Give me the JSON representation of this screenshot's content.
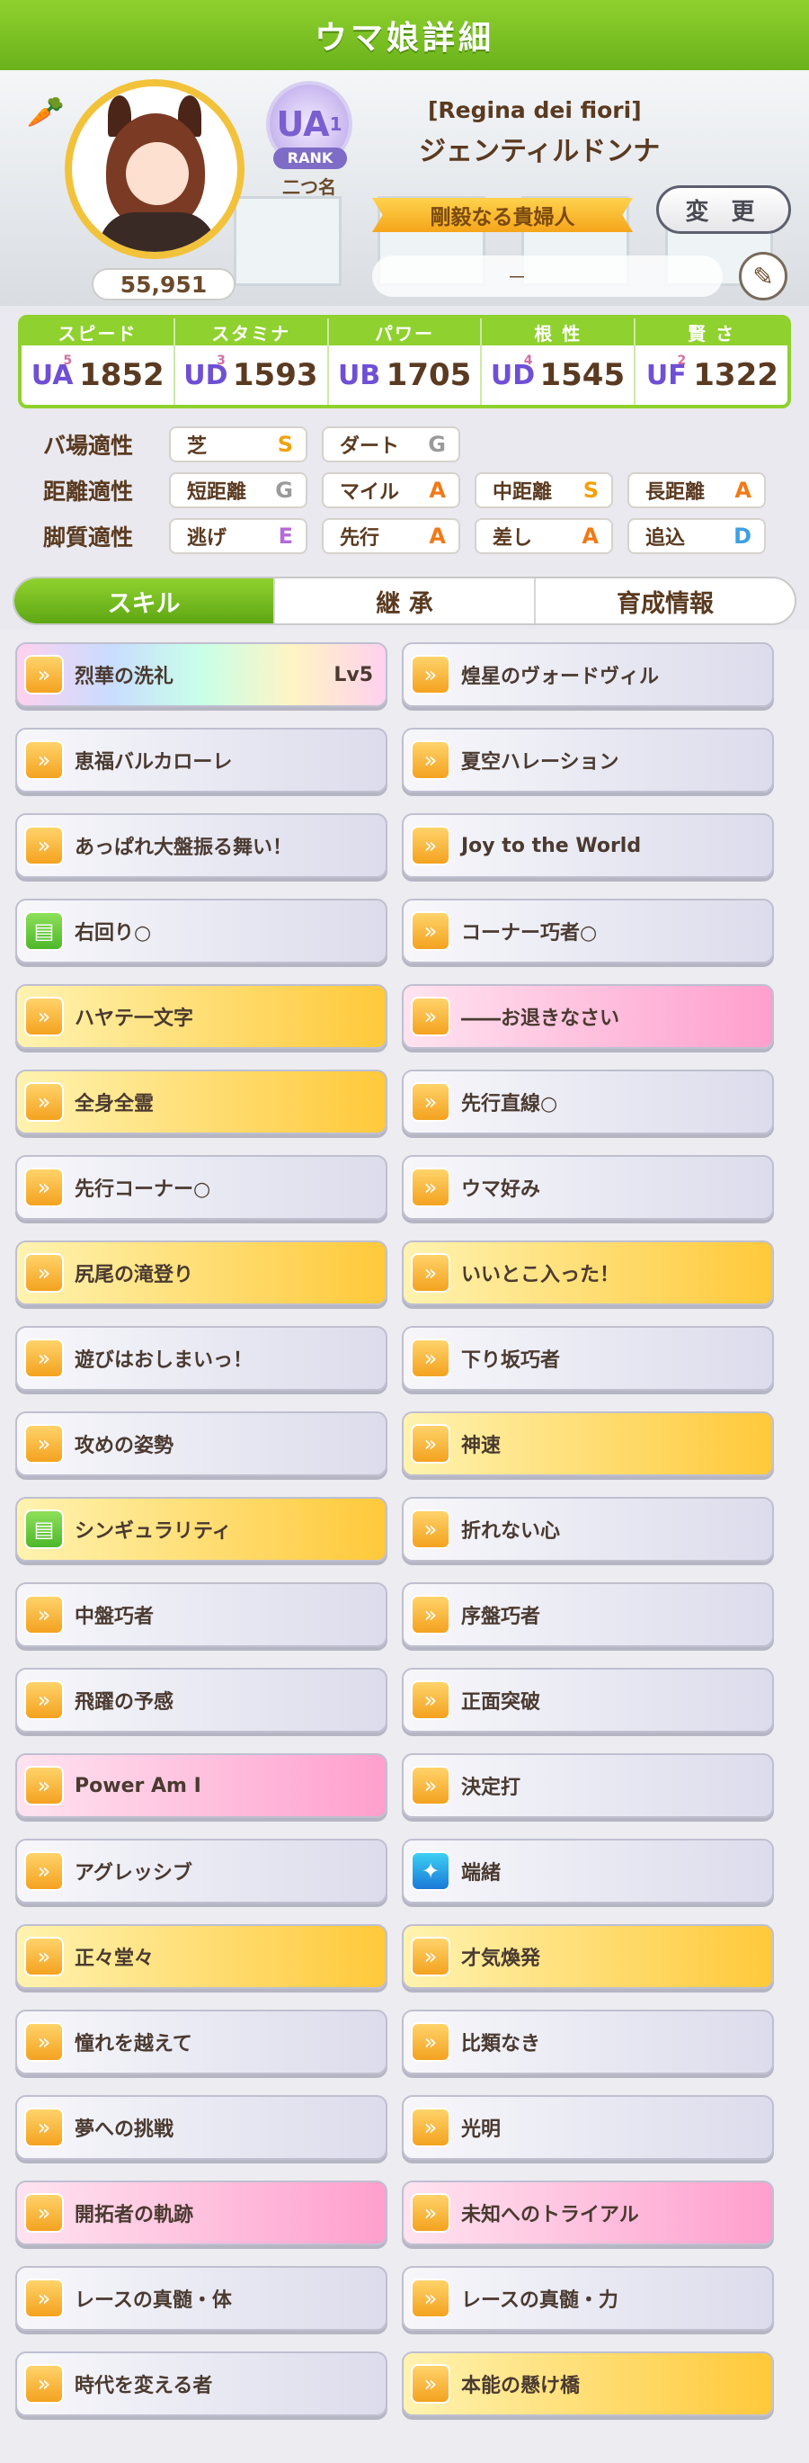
{
  "header": {
    "title": "ウマ娘詳細"
  },
  "profile": {
    "fans": "55,951",
    "rank_grade": "UA",
    "rank_sub": "1",
    "rank_label": "RANK",
    "nickname": "二つ名",
    "epithet": "[Regina dei fiori]",
    "name": "ジェンティルドンナ",
    "title_ribbon": "剛毅なる貴婦人",
    "change_label": "変 更",
    "subtitle_value": "－"
  },
  "stats": [
    {
      "label": "スピード",
      "grade": "UA",
      "grade_sub": "5",
      "value": "1852"
    },
    {
      "label": "スタミナ",
      "grade": "UD",
      "grade_sub": "3",
      "value": "1593"
    },
    {
      "label": "パワー",
      "grade": "UB",
      "grade_sub": "",
      "value": "1705"
    },
    {
      "label": "根 性",
      "grade": "UD",
      "grade_sub": "4",
      "value": "1545"
    },
    {
      "label": "賢 さ",
      "grade": "UF",
      "grade_sub": "2",
      "value": "1322"
    }
  ],
  "aptitude": {
    "surface": {
      "label": "バ場適性",
      "items": [
        {
          "name": "芝",
          "grade": "S"
        },
        {
          "name": "ダート",
          "grade": "G"
        }
      ]
    },
    "distance": {
      "label": "距離適性",
      "items": [
        {
          "name": "短距離",
          "grade": "G"
        },
        {
          "name": "マイル",
          "grade": "A"
        },
        {
          "name": "中距離",
          "grade": "S"
        },
        {
          "name": "長距離",
          "grade": "A"
        }
      ]
    },
    "style": {
      "label": "脚質適性",
      "items": [
        {
          "name": "逃げ",
          "grade": "E"
        },
        {
          "name": "先行",
          "grade": "A"
        },
        {
          "name": "差し",
          "grade": "A"
        },
        {
          "name": "追込",
          "grade": "D"
        }
      ]
    }
  },
  "tabs": [
    {
      "label": "スキル",
      "active": true
    },
    {
      "label": "継 承",
      "active": false
    },
    {
      "label": "育成情報",
      "active": false
    }
  ],
  "skills": [
    {
      "name": "烈華の洗礼",
      "level": "Lv5",
      "tier": "rainbow",
      "icon": "speed-icon"
    },
    {
      "name": "煌星のヴォードヴィル",
      "tier": "normal",
      "icon": "speed-icon"
    },
    {
      "name": "恵福バルカローレ",
      "tier": "normal",
      "icon": "speed-icon"
    },
    {
      "name": "夏空ハレーション",
      "tier": "normal",
      "icon": "speed-icon"
    },
    {
      "name": "あっぱれ大盤振る舞い！",
      "tier": "normal",
      "icon": "speed-icon"
    },
    {
      "name": "Joy to the World",
      "tier": "normal",
      "icon": "speed-icon"
    },
    {
      "name": "右回り○",
      "tier": "normal",
      "icon": "green-card-icon"
    },
    {
      "name": "コーナー巧者○",
      "tier": "normal",
      "icon": "speed-icon"
    },
    {
      "name": "ハヤテ一文字",
      "tier": "gold",
      "icon": "speed-icon"
    },
    {
      "name": "――お退きなさい",
      "tier": "pink",
      "icon": "speed-icon"
    },
    {
      "name": "全身全霊",
      "tier": "gold",
      "icon": "speed-icon"
    },
    {
      "name": "先行直線○",
      "tier": "normal",
      "icon": "speed-icon"
    },
    {
      "name": "先行コーナー○",
      "tier": "normal",
      "icon": "speed-icon"
    },
    {
      "name": "ウマ好み",
      "tier": "normal",
      "icon": "speed-icon"
    },
    {
      "name": "尻尾の滝登り",
      "tier": "gold",
      "icon": "speed-icon"
    },
    {
      "name": "いいとこ入った！",
      "tier": "gold",
      "icon": "speed-icon"
    },
    {
      "name": "遊びはおしまいっ！",
      "tier": "normal",
      "icon": "speed-icon"
    },
    {
      "name": "下り坂巧者",
      "tier": "normal",
      "icon": "speed-icon"
    },
    {
      "name": "攻めの姿勢",
      "tier": "normal",
      "icon": "speed-icon"
    },
    {
      "name": "神速",
      "tier": "gold",
      "icon": "speed-icon"
    },
    {
      "name": "シンギュラリティ",
      "tier": "gold",
      "icon": "green-card-icon"
    },
    {
      "name": "折れない心",
      "tier": "normal",
      "icon": "speed-icon"
    },
    {
      "name": "中盤巧者",
      "tier": "normal",
      "icon": "speed-icon"
    },
    {
      "name": "序盤巧者",
      "tier": "normal",
      "icon": "speed-icon"
    },
    {
      "name": "飛躍の予感",
      "tier": "normal",
      "icon": "speed-icon"
    },
    {
      "name": "正面突破",
      "tier": "normal",
      "icon": "speed-icon"
    },
    {
      "name": "Power Am I",
      "tier": "pink",
      "icon": "speed-icon"
    },
    {
      "name": "決定打",
      "tier": "normal",
      "icon": "speed-icon"
    },
    {
      "name": "アグレッシブ",
      "tier": "normal",
      "icon": "speed-icon"
    },
    {
      "name": "端緒",
      "tier": "normal",
      "icon": "sparkle-icon"
    },
    {
      "name": "正々堂々",
      "tier": "gold",
      "icon": "speed-icon"
    },
    {
      "name": "才気煥発",
      "tier": "gold",
      "icon": "speed-icon"
    },
    {
      "name": "憧れを越えて",
      "tier": "normal",
      "icon": "speed-icon"
    },
    {
      "name": "比類なき",
      "tier": "normal",
      "icon": "speed-icon"
    },
    {
      "name": "夢への挑戦",
      "tier": "normal",
      "icon": "speed-icon"
    },
    {
      "name": "光明",
      "tier": "normal",
      "icon": "speed-icon"
    },
    {
      "name": "開拓者の軌跡",
      "tier": "pink",
      "icon": "speed-icon"
    },
    {
      "name": "未知へのトライアル",
      "tier": "pink",
      "icon": "speed-icon"
    },
    {
      "name": "レースの真髄・体",
      "tier": "normal",
      "icon": "speed-icon"
    },
    {
      "name": "レースの真髄・力",
      "tier": "normal",
      "icon": "speed-icon"
    },
    {
      "name": "時代を変える者",
      "tier": "normal",
      "icon": "speed-icon"
    },
    {
      "name": "本能の懸け橋",
      "tier": "gold",
      "icon": "speed-icon"
    }
  ]
}
